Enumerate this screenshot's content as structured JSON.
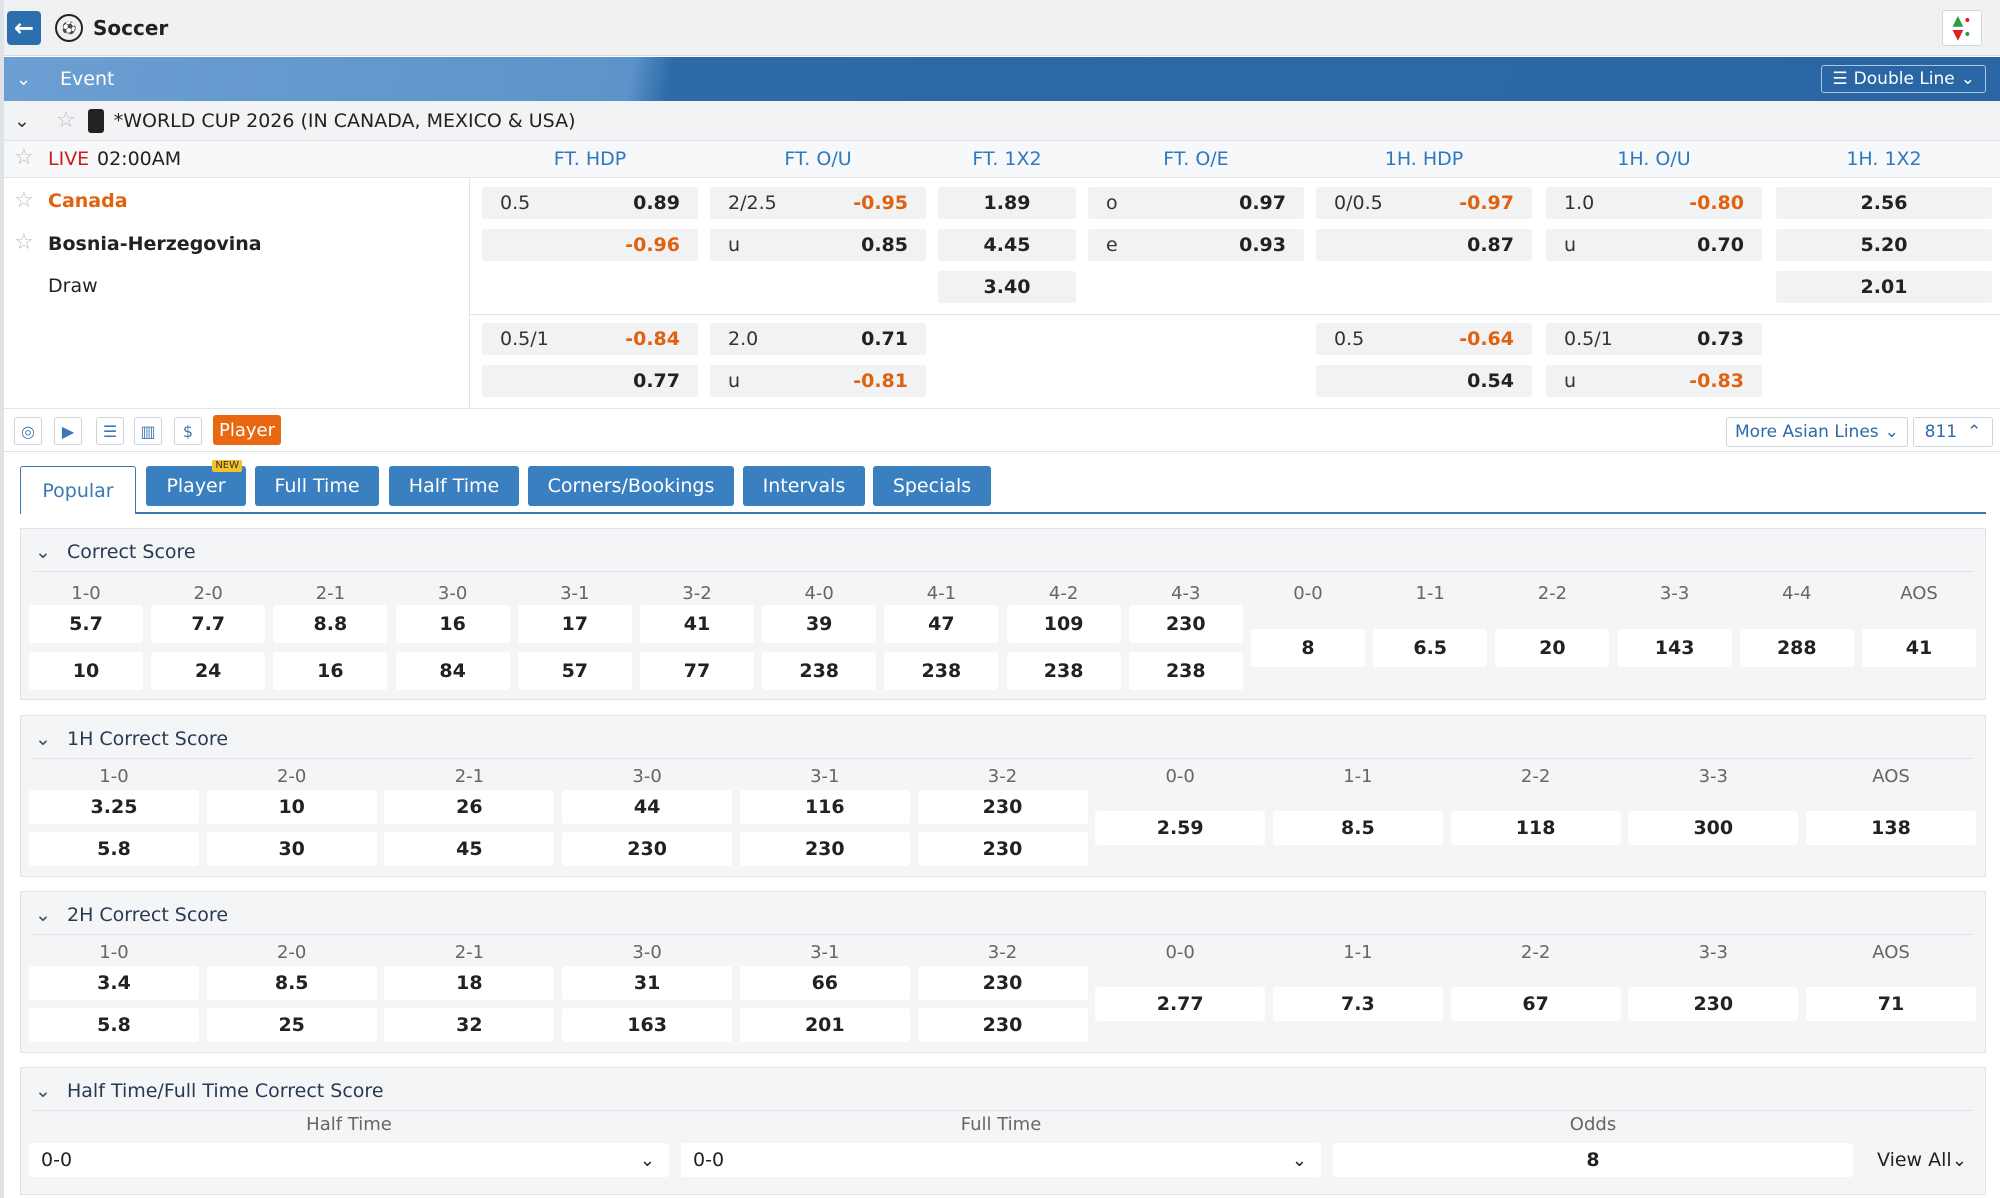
{
  "topbar": {
    "sport": "Soccer"
  },
  "eventbar": {
    "label": "Event",
    "view_mode": "Double Line"
  },
  "league": {
    "name": "*WORLD CUP 2026 (IN CANADA, MEXICO & USA)"
  },
  "match": {
    "live": "LIVE",
    "time": "02:00AM",
    "columns": [
      "FT. HDP",
      "FT. O/U",
      "FT. 1X2",
      "FT. O/E",
      "1H. HDP",
      "1H. O/U",
      "1H. 1X2"
    ],
    "home": "Canada",
    "away": "Bosnia-Herzegovina",
    "draw": "Draw",
    "main": {
      "ft_hdp": {
        "line": "0.5",
        "home": "0.89",
        "away": "-0.96"
      },
      "ft_ou": {
        "line": "2/2.5",
        "over": "-0.95",
        "u": "u",
        "under": "0.85"
      },
      "ft_1x2": {
        "home": "1.89",
        "away": "4.45",
        "draw": "3.40"
      },
      "ft_oe": {
        "o": "o",
        "odd": "0.97",
        "e": "e",
        "even": "0.93"
      },
      "h1_hdp": {
        "line": "0/0.5",
        "home": "-0.97",
        "away": "0.87"
      },
      "h1_ou": {
        "line": "1.0",
        "over": "-0.80",
        "u": "u",
        "under": "0.70"
      },
      "h1_1x2": {
        "home": "2.56",
        "away": "5.20",
        "draw": "2.01"
      }
    },
    "alt": {
      "ft_hdp": {
        "line": "0.5/1",
        "home": "-0.84",
        "away": "0.77"
      },
      "ft_ou": {
        "line": "2.0",
        "over": "0.71",
        "u": "u",
        "under": "-0.81"
      },
      "h1_hdp": {
        "line": "0.5",
        "home": "-0.64",
        "away": "0.54"
      },
      "h1_ou": {
        "line": "0.5/1",
        "over": "0.73",
        "u": "u",
        "under": "-0.83"
      }
    }
  },
  "toolbar": {
    "player": "Player",
    "more_lines": "More Asian Lines",
    "count": "811"
  },
  "tabs": [
    {
      "label": "Popular"
    },
    {
      "label": "Player",
      "badge": "NEW"
    },
    {
      "label": "Full Time"
    },
    {
      "label": "Half Time"
    },
    {
      "label": "Corners/Bookings"
    },
    {
      "label": "Intervals"
    },
    {
      "label": "Specials"
    }
  ],
  "correct_score": {
    "title": "Correct Score",
    "labels": [
      "1-0",
      "2-0",
      "2-1",
      "3-0",
      "3-1",
      "3-2",
      "4-0",
      "4-1",
      "4-2",
      "4-3",
      "0-0",
      "1-1",
      "2-2",
      "3-3",
      "4-4",
      "AOS"
    ],
    "top": [
      "5.7",
      "7.7",
      "8.8",
      "16",
      "17",
      "41",
      "39",
      "47",
      "109",
      "230"
    ],
    "bottom": [
      "10",
      "24",
      "16",
      "84",
      "57",
      "77",
      "238",
      "238",
      "238",
      "238"
    ],
    "single": [
      "8",
      "6.5",
      "20",
      "143",
      "288",
      "41"
    ]
  },
  "h1_correct_score": {
    "title": "1H Correct Score",
    "labels": [
      "1-0",
      "2-0",
      "2-1",
      "3-0",
      "3-1",
      "3-2",
      "0-0",
      "1-1",
      "2-2",
      "3-3",
      "AOS"
    ],
    "top": [
      "3.25",
      "10",
      "26",
      "44",
      "116",
      "230"
    ],
    "bottom": [
      "5.8",
      "30",
      "45",
      "230",
      "230",
      "230"
    ],
    "single": [
      "2.59",
      "8.5",
      "118",
      "300",
      "138"
    ]
  },
  "h2_correct_score": {
    "title": "2H Correct Score",
    "labels": [
      "1-0",
      "2-0",
      "2-1",
      "3-0",
      "3-1",
      "3-2",
      "0-0",
      "1-1",
      "2-2",
      "3-3",
      "AOS"
    ],
    "top": [
      "3.4",
      "8.5",
      "18",
      "31",
      "66",
      "230"
    ],
    "bottom": [
      "5.8",
      "25",
      "32",
      "163",
      "201",
      "230"
    ],
    "single": [
      "2.77",
      "7.3",
      "67",
      "230",
      "71"
    ]
  },
  "htft": {
    "title": "Half Time/Full Time Correct Score",
    "half_label": "Half Time",
    "full_label": "Full Time",
    "odds_label": "Odds",
    "half_value": "0-0",
    "full_value": "0-0",
    "odds": "8",
    "view_all": "View All"
  }
}
